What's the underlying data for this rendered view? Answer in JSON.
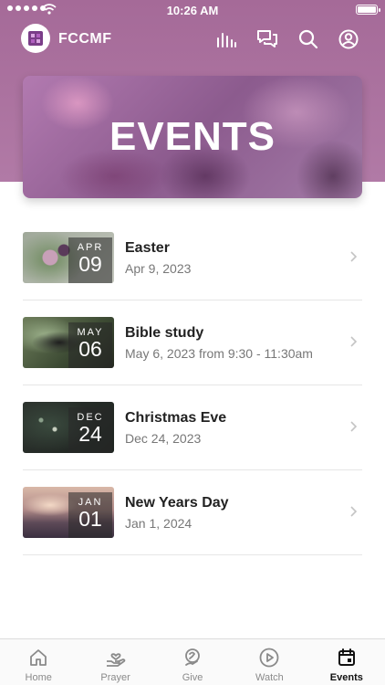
{
  "status_bar": {
    "time": "10:26 AM"
  },
  "header": {
    "app_name": "FCCMF",
    "icons": [
      "bar-chart-icon",
      "chat-icon",
      "search-icon",
      "profile-icon"
    ]
  },
  "banner": {
    "title": "EVENTS"
  },
  "events": [
    {
      "month": "APR",
      "day": "09",
      "title": "Easter",
      "subtitle": "Apr 9, 2023"
    },
    {
      "month": "MAY",
      "day": "06",
      "title": "Bible study",
      "subtitle": "May 6, 2023 from 9:30 - 11:30am"
    },
    {
      "month": "DEC",
      "day": "24",
      "title": "Christmas Eve",
      "subtitle": "Dec 24, 2023"
    },
    {
      "month": "JAN",
      "day": "01",
      "title": "New Years Day",
      "subtitle": "Jan 1, 2024"
    }
  ],
  "tabs": [
    {
      "label": "Home",
      "icon": "home-icon"
    },
    {
      "label": "Prayer",
      "icon": "prayer-hand-icon"
    },
    {
      "label": "Give",
      "icon": "give-icon"
    },
    {
      "label": "Watch",
      "icon": "play-icon"
    },
    {
      "label": "Events",
      "icon": "calendar-icon",
      "active": true
    }
  ],
  "colors": {
    "accent": "#a56a98",
    "active_tab": "#111111"
  }
}
